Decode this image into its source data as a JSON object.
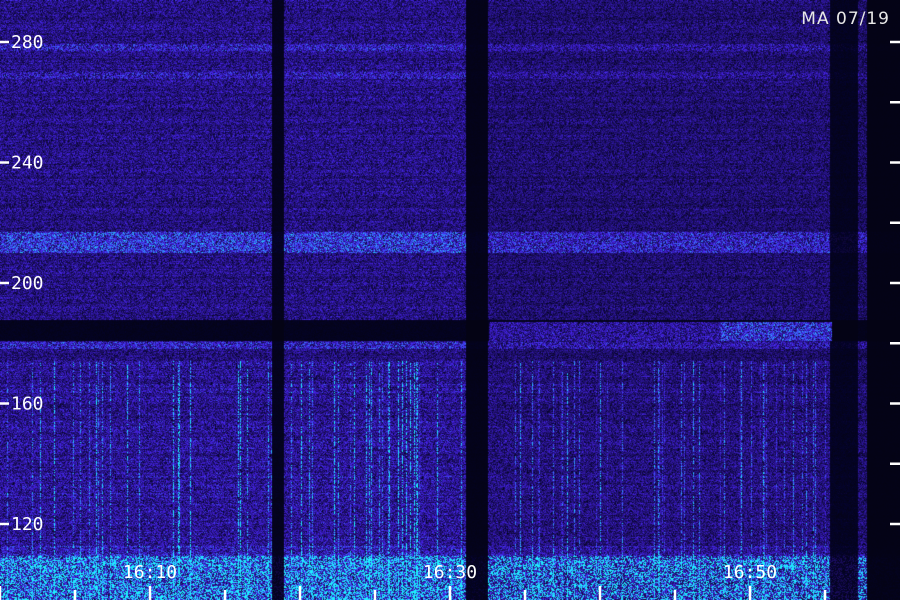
{
  "chart_data": {
    "type": "heatmap",
    "title": "",
    "stamp": "MA 07/19",
    "xlabel": "",
    "ylabel": "",
    "y_ticks": [
      280,
      240,
      200,
      160,
      120
    ],
    "x_ticks": [
      "16:10",
      "16:30",
      "16:50"
    ],
    "x_range_minutes": [
      16.0,
      16.95
    ],
    "colormap": {
      "low": "#06051a",
      "mid": "#3a1fd8",
      "high": "#2bc7ff",
      "peak": "#7affff"
    },
    "background": "#000000",
    "axis_color": "#ffffff"
  }
}
